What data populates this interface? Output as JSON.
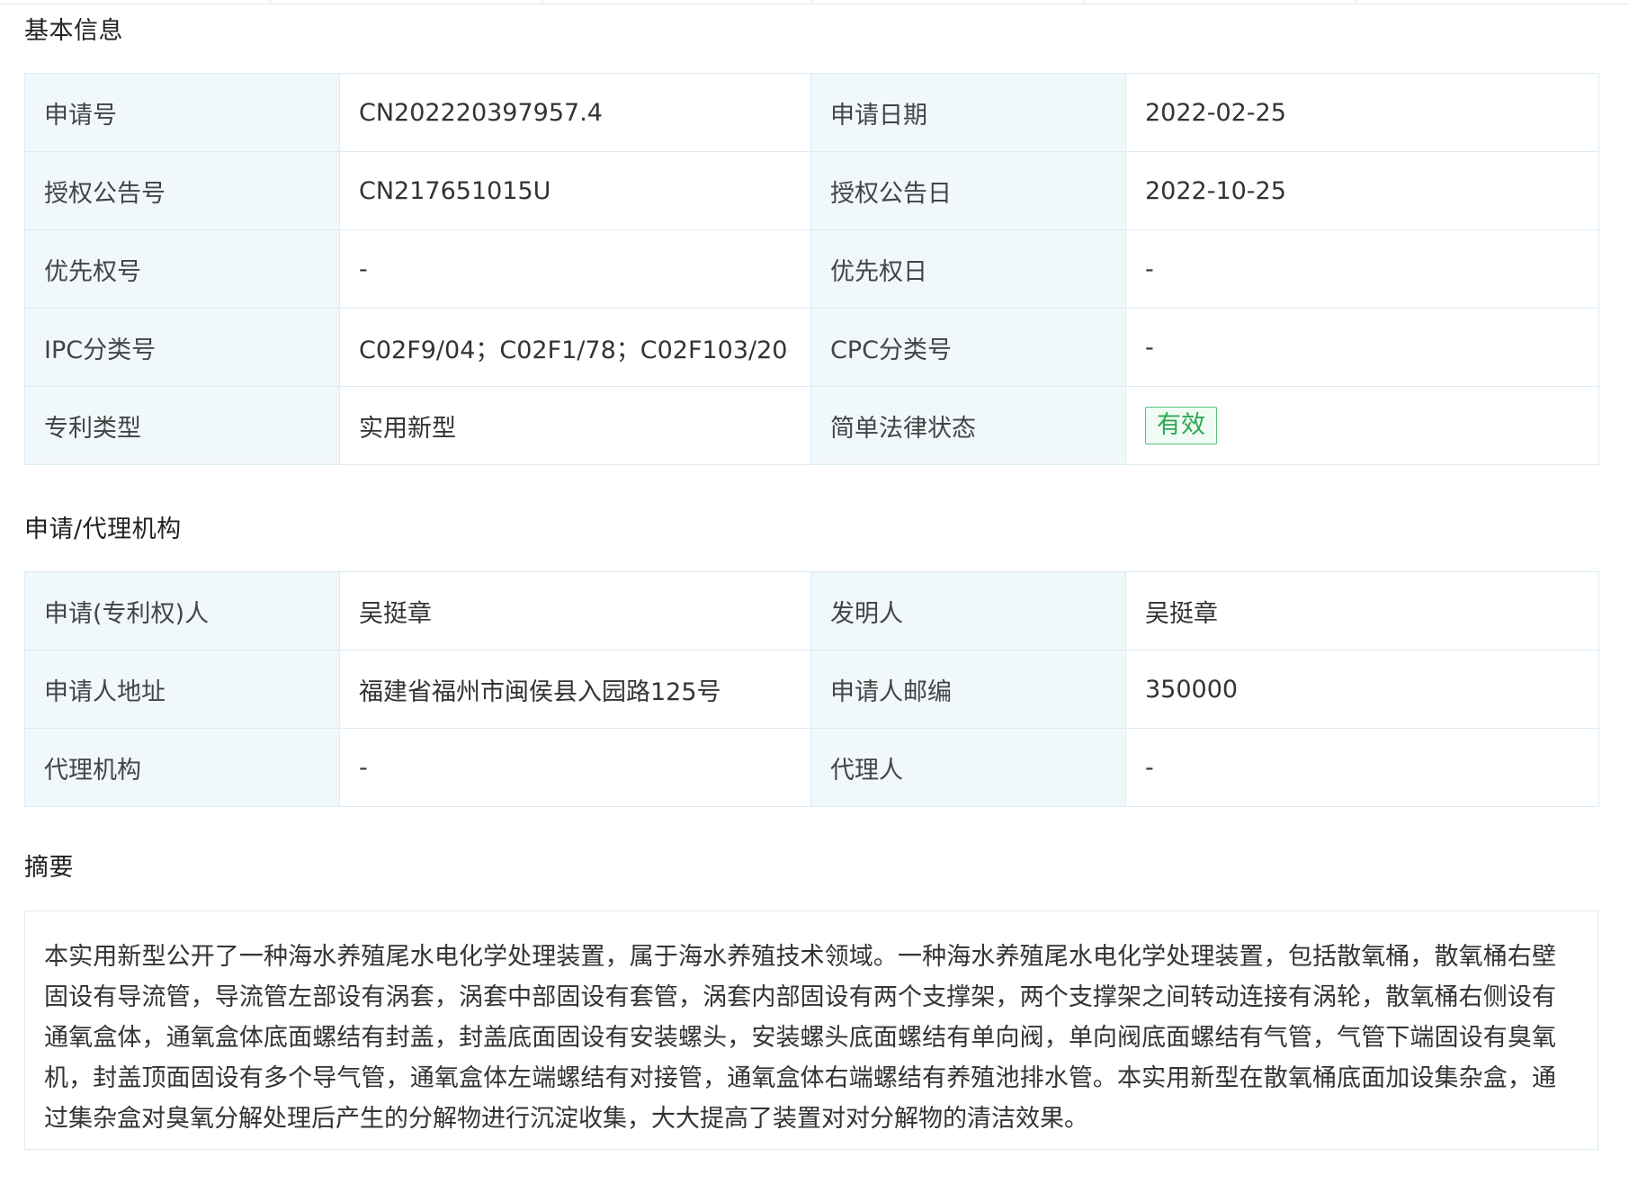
{
  "sections": {
    "basic": {
      "title": "基本信息",
      "rows": [
        {
          "label1": "申请号",
          "value1": "CN202220397957.4",
          "label2": "申请日期",
          "value2": "2022-02-25"
        },
        {
          "label1": "授权公告号",
          "value1": "CN217651015U",
          "label2": "授权公告日",
          "value2": "2022-10-25"
        },
        {
          "label1": "优先权号",
          "value1": "-",
          "label2": "优先权日",
          "value2": "-"
        },
        {
          "label1": "IPC分类号",
          "value1": "C02F9/04；C02F1/78；C02F103/20",
          "label2": "CPC分类号",
          "value2": "-"
        },
        {
          "label1": "专利类型",
          "value1": "实用新型",
          "label2": "简单法律状态",
          "value2": "有效"
        }
      ]
    },
    "agent": {
      "title": "申请/代理机构",
      "rows": [
        {
          "label1": "申请(专利权)人",
          "value1": "吴挺章",
          "label2": "发明人",
          "value2": "吴挺章"
        },
        {
          "label1": "申请人地址",
          "value1": "福建省福州市闽侯县入园路125号",
          "label2": "申请人邮编",
          "value2": "350000"
        },
        {
          "label1": "代理机构",
          "value1": "-",
          "label2": "代理人",
          "value2": "-"
        }
      ]
    },
    "abstract": {
      "title": "摘要",
      "text": "本实用新型公开了一种海水养殖尾水电化学处理装置，属于海水养殖技术领域。一种海水养殖尾水电化学处理装置，包括散氧桶，散氧桶右壁固设有导流管，导流管左部设有涡套，涡套中部固设有套管，涡套内部固设有两个支撑架，两个支撑架之间转动连接有涡轮，散氧桶右侧设有通氧盒体，通氧盒体底面螺结有封盖，封盖底面固设有安装螺头，安装螺头底面螺结有单向阀，单向阀底面螺结有气管，气管下端固设有臭氧机，封盖顶面固设有多个导气管，通氧盒体左端螺结有对接管，通氧盒体右端螺结有养殖池排水管。本实用新型在散氧桶底面加设集杂盒，通过集杂盒对臭氧分解处理后产生的分解物进行沉淀收集，大大提高了装置对对分解物的清洁效果。"
    }
  },
  "colors": {
    "label_bg": "#f1f8fc",
    "border": "#dbeaf3",
    "status_valid": "#2aa852"
  }
}
